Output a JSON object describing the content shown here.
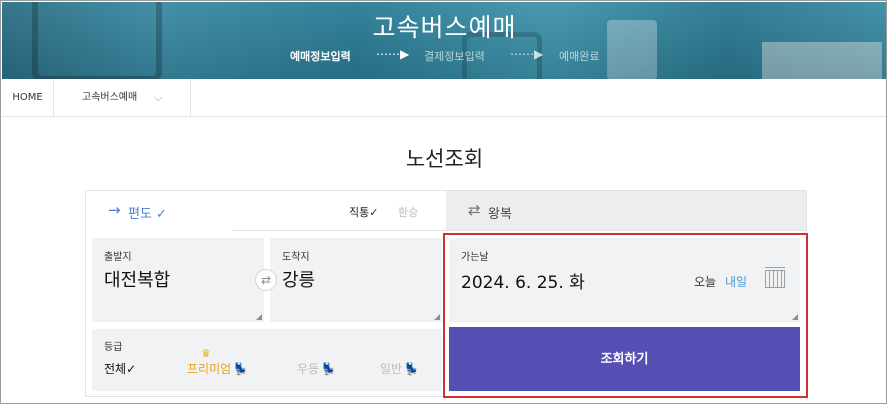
{
  "hero": {
    "title": "고속버스예매",
    "steps": [
      {
        "label": "예매정보입력",
        "active": true
      },
      {
        "label": "결제정보입력",
        "active": false
      },
      {
        "label": "예매완료",
        "active": false
      }
    ],
    "step_arrow": "⋯⋯▶"
  },
  "breadcrumb": {
    "home": "HOME",
    "current": "고속버스예매",
    "chevron": "⌵"
  },
  "page_title": "노선조회",
  "trip": {
    "oneway_label": "편도 ✓",
    "oneway_icon": "→",
    "direct_label": "직통✓",
    "transfer_label": "환승",
    "round_label": "왕복",
    "round_icon": "⇄"
  },
  "departure": {
    "caption": "출발지",
    "value": "대전복합"
  },
  "arrival": {
    "caption": "도착지",
    "value": "강릉"
  },
  "swap_icon": "⇄",
  "date": {
    "caption": "가는날",
    "value": "2024. 6. 25. 화",
    "today": "오늘",
    "tomorrow": "내일"
  },
  "grade": {
    "caption": "등급",
    "options": {
      "all": "전체✓",
      "premium": "프리미엄",
      "first": "우등",
      "normal": "일반"
    },
    "crown_icon": "♛",
    "seat_icon": "💺"
  },
  "search_button": "조회하기",
  "colors": {
    "accent": "#5750b4",
    "link": "#4a7fd8",
    "premium": "#e8a21a",
    "highlight": "#d32f2f"
  }
}
